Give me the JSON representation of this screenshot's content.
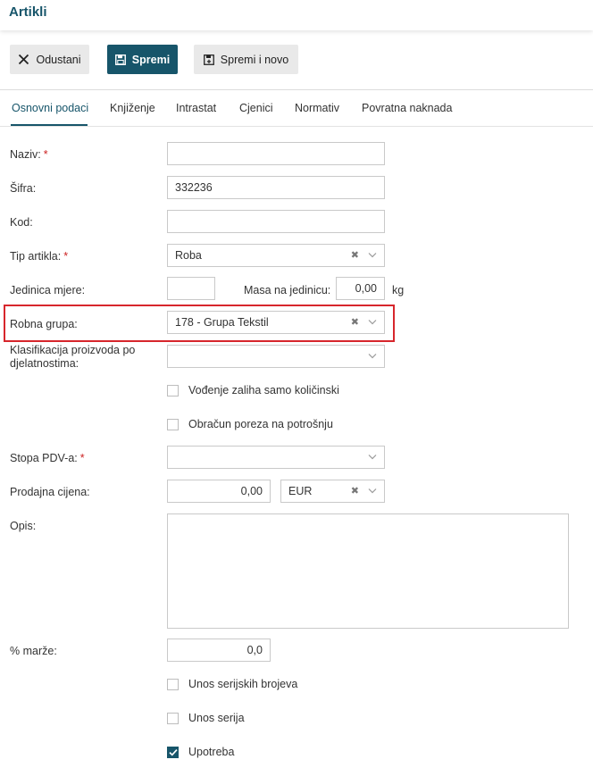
{
  "header": {
    "title": "Artikli"
  },
  "toolbar": {
    "cancel_label": "Odustani",
    "save_label": "Spremi",
    "save_new_label": "Spremi i novo"
  },
  "tabs": [
    {
      "label": "Osnovni podaci"
    },
    {
      "label": "Knjiženje"
    },
    {
      "label": "Intrastat"
    },
    {
      "label": "Cjenici"
    },
    {
      "label": "Normativ"
    },
    {
      "label": "Povratna naknada"
    }
  ],
  "form": {
    "naziv": {
      "label": "Naziv:",
      "required": "*",
      "value": ""
    },
    "sifra": {
      "label": "Šifra:",
      "value": "332236"
    },
    "kod": {
      "label": "Kod:",
      "value": ""
    },
    "tip_artikla": {
      "label": "Tip artikla:",
      "required": "*",
      "value": "Roba",
      "clear": "✖"
    },
    "jedinica_mjere": {
      "label": "Jedinica mjere:",
      "value": ""
    },
    "masa": {
      "label": "Masa na jedinicu:",
      "value": "0,00",
      "unit": "kg"
    },
    "robna_grupa": {
      "label": "Robna grupa:",
      "value": "178 - Grupa Tekstil",
      "clear": "✖"
    },
    "klasifikacija": {
      "label_line1": "Klasifikacija proizvoda po",
      "label_line2": "djelatnostima:",
      "value": ""
    },
    "vodenje_zaliha": {
      "label": "Vođenje zaliha samo količinski",
      "checked": false
    },
    "obracun_poreza": {
      "label": "Obračun poreza na potrošnju",
      "checked": false
    },
    "stopa_pdv": {
      "label": "Stopa PDV-a:",
      "required": "*",
      "value": ""
    },
    "prodajna_cijena": {
      "label": "Prodajna cijena:",
      "value": "0,00",
      "currency": "EUR",
      "clear": "✖"
    },
    "opis": {
      "label": "Opis:",
      "value": ""
    },
    "marza": {
      "label": "% marže:",
      "value": "0,0"
    },
    "unos_serijskih": {
      "label": "Unos serijskih brojeva",
      "checked": false
    },
    "unos_serija": {
      "label": "Unos serija",
      "checked": false
    },
    "upotreba": {
      "label": "Upotreba",
      "checked": true
    }
  },
  "colors": {
    "accent": "#17556a",
    "highlight": "#d7262c",
    "required": "#cc2222"
  },
  "icons": {
    "cancel": "close-icon",
    "save": "floppy-disk-icon",
    "save_new": "floppy-disk-plus-icon",
    "dropdown": "chevron-down-icon",
    "clear": "clear-x-icon",
    "check": "checkmark-icon"
  }
}
